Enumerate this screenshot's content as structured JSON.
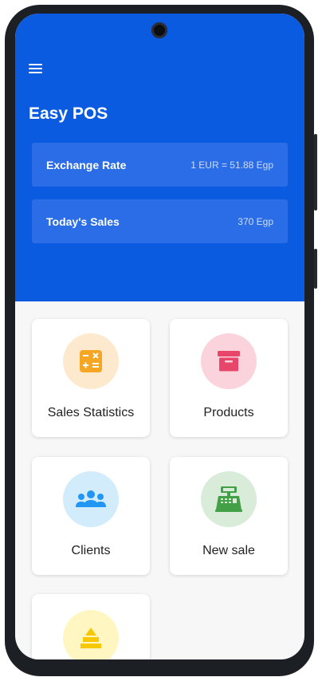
{
  "app": {
    "title": "Easy POS"
  },
  "menu": {
    "icon": "menu-icon"
  },
  "exchange": {
    "label": "Exchange Rate",
    "value": "1 EUR = 51.88 Egp"
  },
  "sales_today": {
    "label": "Today's Sales",
    "value": "370 Egp"
  },
  "tiles": [
    {
      "label": "Sales Statistics",
      "icon": "calculator-icon",
      "bg": "#fde9cd",
      "color": "#f5a623"
    },
    {
      "label": "Products",
      "icon": "archive-box-icon",
      "bg": "#fbd3dd",
      "color": "#e8456b"
    },
    {
      "label": "Clients",
      "icon": "people-group-icon",
      "bg": "#d3ecfb",
      "color": "#2196f3"
    },
    {
      "label": "New sale",
      "icon": "cash-register-icon",
      "bg": "#d9ecd9",
      "color": "#43a047"
    },
    {
      "label": "",
      "icon": "stacked-bars-icon",
      "bg": "#fff6c2",
      "color": "#f7c800"
    }
  ],
  "colors": {
    "primary": "#0a5be0",
    "card": "#2b6de6",
    "background": "#f7f7f7"
  }
}
